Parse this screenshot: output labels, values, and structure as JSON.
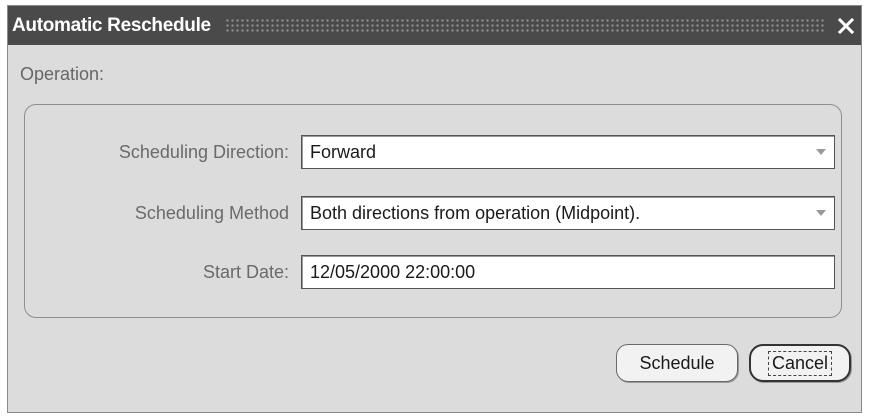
{
  "window": {
    "title": "Automatic Reschedule"
  },
  "icons": {
    "close": "close-icon",
    "dropdown": "chevron-down-icon"
  },
  "form": {
    "operation_label": "Operation:",
    "scheduling_direction": {
      "label": "Scheduling Direction:",
      "value": "Forward"
    },
    "scheduling_method": {
      "label": "Scheduling Method",
      "value": "Both directions from operation (Midpoint)."
    },
    "start_date": {
      "label": "Start Date:",
      "value": "12/05/2000 22:00:00"
    }
  },
  "buttons": {
    "schedule": "Schedule",
    "cancel": "Cancel"
  },
  "colors": {
    "titlebar": "#4a4a4a",
    "window_bg": "#dcdcdc"
  }
}
